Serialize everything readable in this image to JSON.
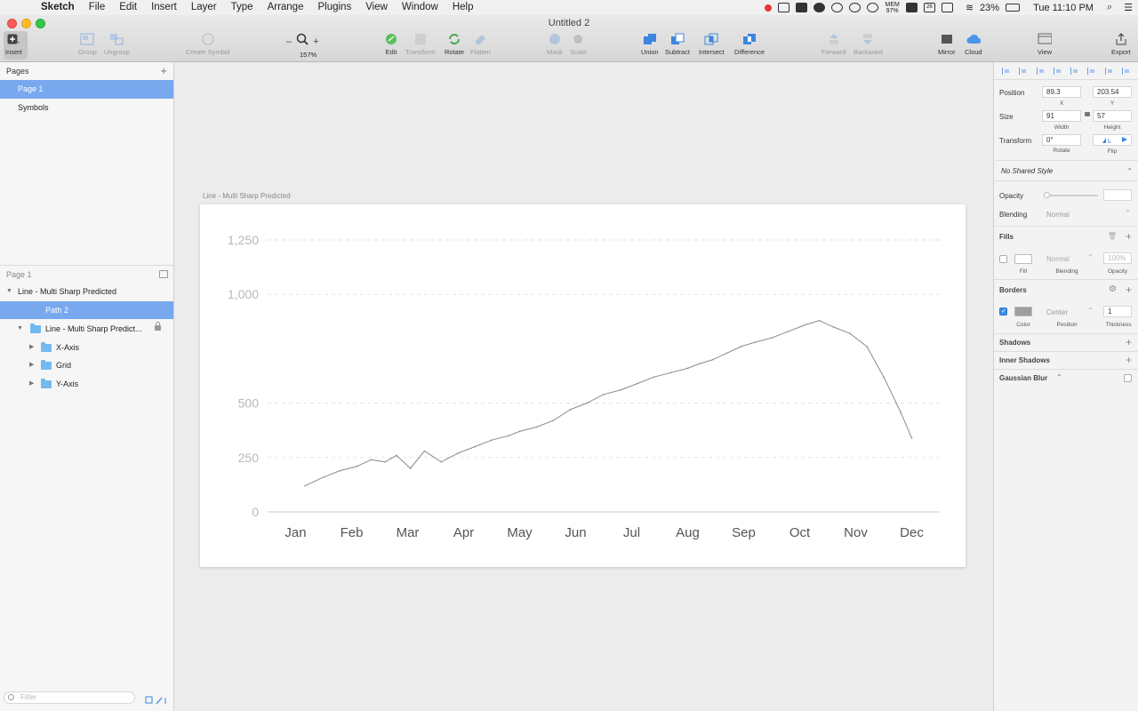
{
  "menubar": {
    "app": "Sketch",
    "items": [
      "File",
      "Edit",
      "Insert",
      "Layer",
      "Type",
      "Arrange",
      "Plugins",
      "View",
      "Window",
      "Help"
    ],
    "mem_label": "MEM",
    "mem_value": "97%",
    "calendar_day": "26",
    "battery": "23%",
    "clock": "Tue 11:10 PM"
  },
  "window": {
    "title": "Untitled 2"
  },
  "toolbar": {
    "insert": "Insert",
    "group": "Group",
    "ungroup": "Ungroup",
    "create_symbol": "Create Symbol",
    "zoom_minus": "–",
    "zoom_plus": "+",
    "zoom_level": "157%",
    "edit": "Edit",
    "transform": "Transform",
    "rotate": "Rotate",
    "flatten": "Flatten",
    "mask": "Mask",
    "scale": "Scale",
    "union": "Union",
    "subtract": "Subtract",
    "intersect": "Intersect",
    "difference": "Difference",
    "forward": "Forward",
    "backward": "Backward",
    "mirror": "Mirror",
    "cloud": "Cloud",
    "view": "View",
    "export": "Export"
  },
  "pages": {
    "header": "Pages",
    "items": [
      "Page 1",
      "Symbols"
    ]
  },
  "layers": {
    "header": "Page 1",
    "artboard": "Line - Multi Sharp Predicted",
    "selected_path": "Path 2",
    "group": "Line - Multi Sharp Predict...",
    "folders": [
      "X-Axis",
      "Grid",
      "Y-Axis"
    ],
    "filter_placeholder": "Filter"
  },
  "canvas": {
    "artboard_label": "Line - Multi Sharp Predicted"
  },
  "chart_data": {
    "type": "line",
    "title": "",
    "xlabel": "",
    "ylabel": "",
    "categories": [
      "Jan",
      "Feb",
      "Mar",
      "Apr",
      "May",
      "Jun",
      "Jul",
      "Aug",
      "Sep",
      "Oct",
      "Nov",
      "Dec"
    ],
    "y_ticks": [
      "0",
      "250",
      "500",
      "1,000",
      "1,250"
    ],
    "y_tick_values": [
      0,
      250,
      500,
      1000,
      1250
    ],
    "ylim": [
      0,
      1250
    ],
    "grid": true,
    "line_color": "#8a8a8a",
    "series": [
      {
        "x": [
          0.17,
          0.5,
          0.8,
          1.1,
          1.35,
          1.6,
          1.8,
          2.05,
          2.3,
          2.6,
          2.9,
          3.2,
          3.5,
          3.8,
          4.0,
          4.3,
          4.6,
          4.9,
          5.2,
          5.5,
          5.8,
          6.1,
          6.4,
          6.7,
          7.0,
          7.2,
          7.45,
          7.7,
          7.95,
          8.2,
          8.5,
          8.8,
          9.1,
          9.35,
          9.6,
          9.9,
          10.2,
          10.5,
          10.8,
          11.0
        ],
        "y": [
          120,
          160,
          190,
          210,
          240,
          230,
          260,
          200,
          280,
          230,
          270,
          300,
          330,
          350,
          370,
          390,
          420,
          470,
          500,
          540,
          560,
          590,
          620,
          640,
          660,
          680,
          700,
          730,
          760,
          780,
          800,
          830,
          860,
          880,
          850,
          820,
          760,
          620,
          460,
          340
        ]
      }
    ]
  },
  "inspector": {
    "position_label": "Position",
    "x_value": "89.3",
    "y_value": "203.54",
    "x_sub": "X",
    "y_sub": "Y",
    "size_label": "Size",
    "width_value": "91",
    "height_value": "57",
    "width_sub": "Width",
    "height_sub": "Height",
    "transform_label": "Transform",
    "rotate_value": "0°",
    "rotate_sub": "Rotate",
    "flip_sub": "Flip",
    "shared_style": "No Shared Style",
    "opacity_label": "Opacity",
    "blending_label": "Blending",
    "blending_value": "Normal",
    "fills_title": "Fills",
    "fill_sub": "Fill",
    "fill_blending": "Normal",
    "fill_blending_sub": "Blending",
    "fill_opacity": "100%",
    "fill_opacity_sub": "Opacity",
    "borders_title": "Borders",
    "border_color": "#9e9e9e",
    "border_color_sub": "Color",
    "border_position": "Center",
    "border_position_sub": "Position",
    "border_thickness": "1",
    "border_thickness_sub": "Thickness",
    "shadows_title": "Shadows",
    "inner_shadows_title": "Inner Shadows",
    "gaussian_blur_title": "Gaussian Blur"
  }
}
